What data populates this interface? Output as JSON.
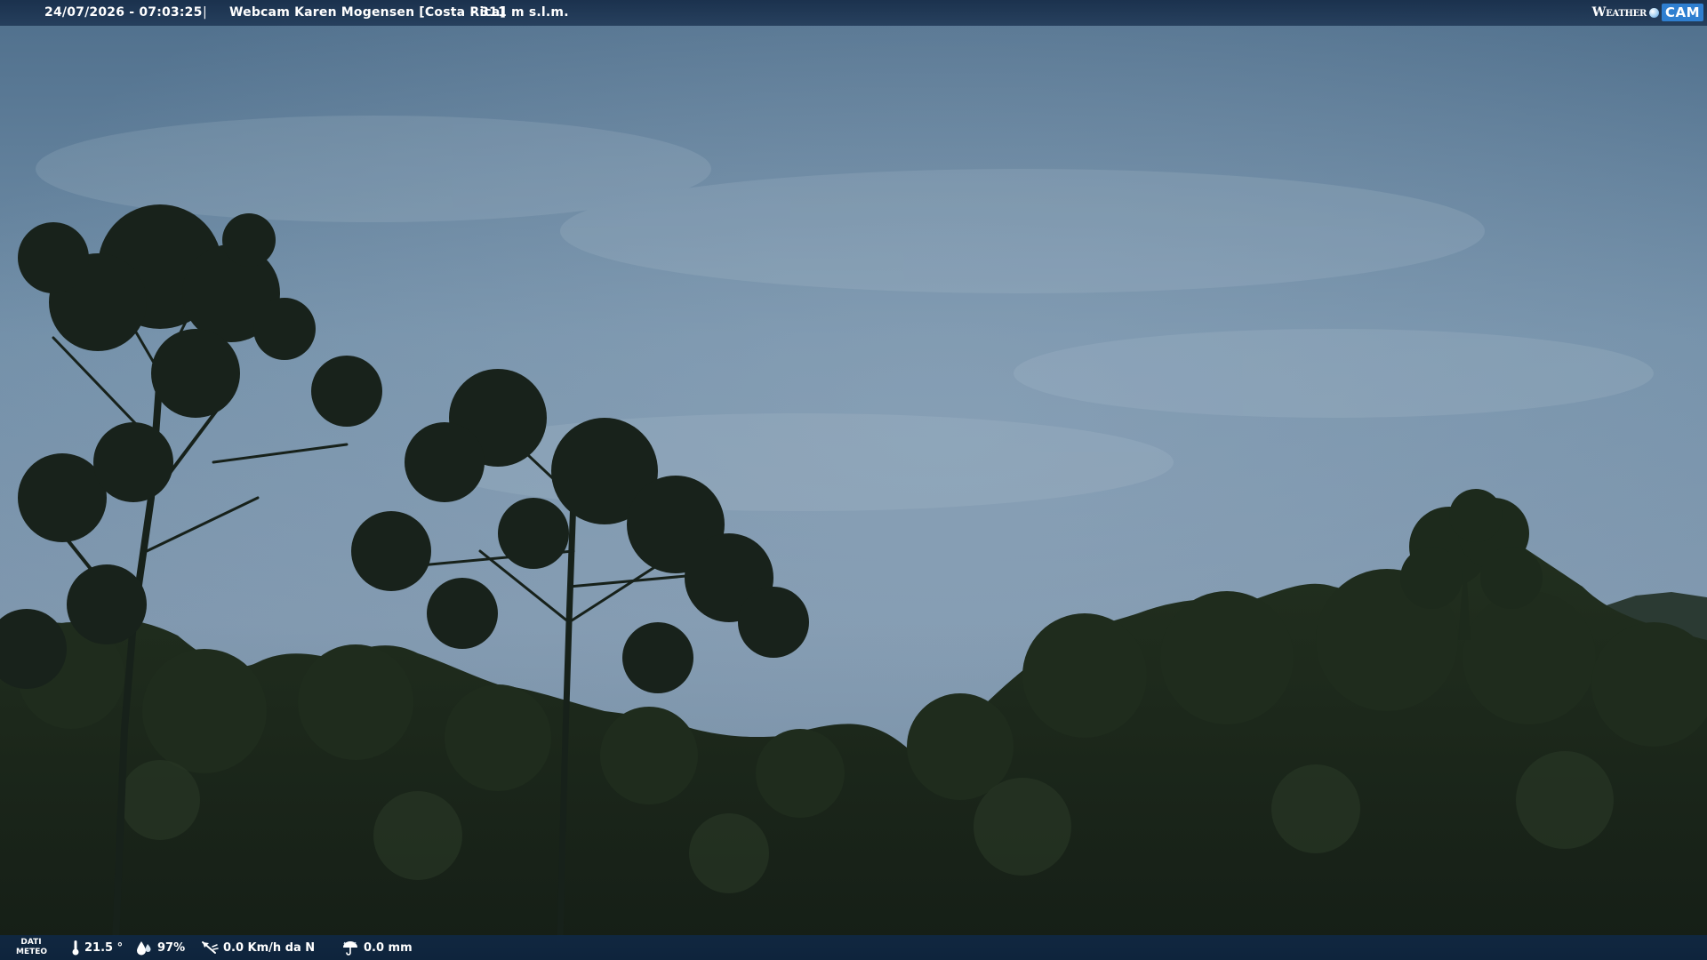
{
  "header": {
    "datetime": "24/07/2026 - 07:03:25",
    "separator": "|",
    "title": "Webcam Karen Mogensen [Costa Rica]",
    "altitude": "- 311 m s.l.m."
  },
  "logo": {
    "weather_text": "Weather",
    "cam_text": "CAM"
  },
  "weather_data": {
    "label_line1": "DATI",
    "label_line2": "METEO",
    "temperature": "21.5 °",
    "humidity": "97%",
    "wind": "0.0 Km/h da N",
    "rain": "0.0 mm"
  },
  "icons": {
    "temperature": "thermometer-icon",
    "humidity": "humidity-drops-icon",
    "wind": "wind-vane-icon",
    "rain": "rain-umbrella-icon"
  },
  "colors": {
    "bar": "#1c3452",
    "sky": "#6f8ea6",
    "foliage": "#1c2a1e",
    "logo_accent": "#2f7fd0"
  }
}
